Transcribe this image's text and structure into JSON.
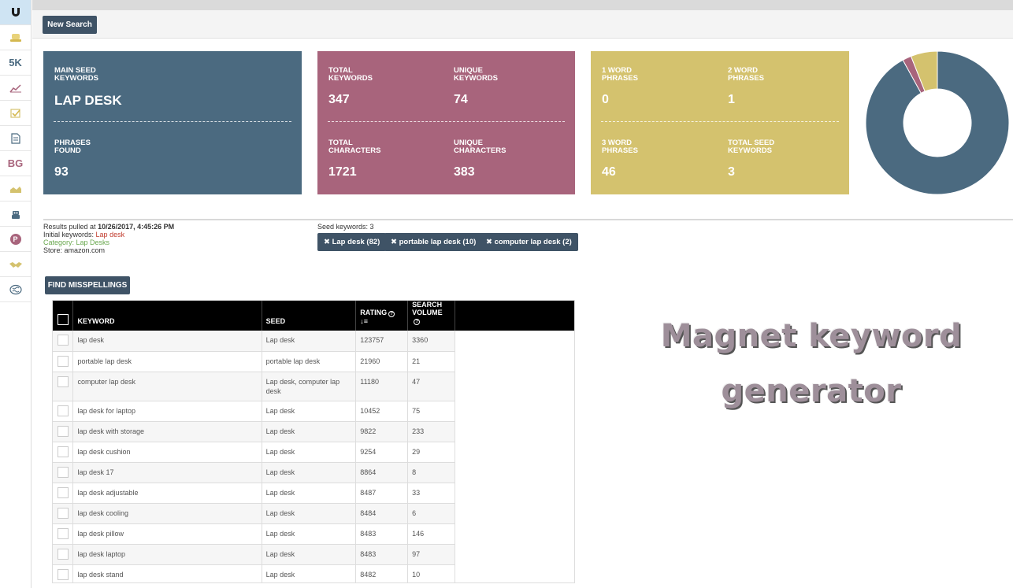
{
  "sidebar": {
    "items": [
      {
        "name": "magnet-icon",
        "text": ""
      },
      {
        "name": "hat-icon",
        "text": ""
      },
      {
        "name": "5k-icon",
        "text": "5K"
      },
      {
        "name": "chart-line-icon",
        "text": ""
      },
      {
        "name": "checklist-icon",
        "text": ""
      },
      {
        "name": "document-icon",
        "text": ""
      },
      {
        "name": "bg-icon",
        "text": "BG"
      },
      {
        "name": "area-chart-icon",
        "text": ""
      },
      {
        "name": "robot-icon",
        "text": ""
      },
      {
        "name": "p-circle-icon",
        "text": "P"
      },
      {
        "name": "handshake-icon",
        "text": ""
      },
      {
        "name": "brain-icon",
        "text": ""
      }
    ],
    "colors": {
      "active_bg": "#cfe4f3"
    }
  },
  "toolbar": {
    "new_search_label": "New Search"
  },
  "cards": {
    "seed": {
      "main_seed_label": "MAIN SEED KEYWORDS",
      "main_seed_value": "LAP DESK",
      "phrases_found_label": "PHRASES FOUND",
      "phrases_found_value": "93",
      "color": "#4b6a80"
    },
    "keywords": {
      "total_keywords_label": "TOTAL KEYWORDS",
      "total_keywords_value": "347",
      "unique_keywords_label": "UNIQUE KEYWORDS",
      "unique_keywords_value": "74",
      "total_characters_label": "TOTAL CHARACTERS",
      "total_characters_value": "1721",
      "unique_characters_label": "UNIQUE CHARACTERS",
      "unique_characters_value": "383",
      "color": "#a8647c"
    },
    "phrases": {
      "one_word_label": "1 WORD PHRASES",
      "one_word_value": "0",
      "two_word_label": "2 WORD PHRASES",
      "two_word_value": "1",
      "three_word_label": "3 WORD PHRASES",
      "three_word_value": "46",
      "total_seed_label": "TOTAL SEED KEYWORDS",
      "total_seed_value": "3",
      "color": "#d4c26e"
    }
  },
  "chart_data": {
    "type": "pie",
    "values": [
      46,
      1,
      3
    ],
    "colors": [
      "#4b6a80",
      "#a8647c",
      "#d4c26e"
    ],
    "hole": true
  },
  "info": {
    "results_pulled_prefix": "Results pulled at",
    "results_pulled_time": "10/26/2017, 4:45:26 PM",
    "initial_keywords_prefix": "Initial keywords:",
    "initial_keywords_value": "Lap desk",
    "category_text": "Category: Lap Desks",
    "store_text": "Store: amazon.com",
    "seed_keywords_text": "Seed keywords: 3"
  },
  "chips": [
    {
      "label": "✖ Lap desk (82)"
    },
    {
      "label": "✖ portable lap desk (10)"
    },
    {
      "label": "✖ computer lap desk (2)"
    }
  ],
  "find_misspellings_label": "FIND MISSPELLINGS",
  "table": {
    "headers": {
      "keyword": "KEYWORD",
      "seed": "SEED",
      "rating": "RATING",
      "search_volume": "SEARCH VOLUME"
    },
    "rows": [
      {
        "keyword": "lap desk",
        "seed": "Lap desk",
        "rating": "123757",
        "volume": "3360"
      },
      {
        "keyword": "portable lap desk",
        "seed": "portable lap desk",
        "rating": "21960",
        "volume": "21"
      },
      {
        "keyword": "computer lap desk",
        "seed": "Lap desk, computer lap desk",
        "rating": "11180",
        "volume": "47"
      },
      {
        "keyword": "lap desk for laptop",
        "seed": "Lap desk",
        "rating": "10452",
        "volume": "75"
      },
      {
        "keyword": "lap desk with storage",
        "seed": "Lap desk",
        "rating": "9822",
        "volume": "233"
      },
      {
        "keyword": "lap desk cushion",
        "seed": "Lap desk",
        "rating": "9254",
        "volume": "29"
      },
      {
        "keyword": "lap desk 17",
        "seed": "Lap desk",
        "rating": "8864",
        "volume": "8"
      },
      {
        "keyword": "lap desk adjustable",
        "seed": "Lap desk",
        "rating": "8487",
        "volume": "33"
      },
      {
        "keyword": "lap desk cooling",
        "seed": "Lap desk",
        "rating": "8484",
        "volume": "6"
      },
      {
        "keyword": "lap desk pillow",
        "seed": "Lap desk",
        "rating": "8483",
        "volume": "146"
      },
      {
        "keyword": "lap desk laptop",
        "seed": "Lap desk",
        "rating": "8483",
        "volume": "97"
      },
      {
        "keyword": "lap desk stand",
        "seed": "Lap desk",
        "rating": "8482",
        "volume": "10"
      }
    ]
  },
  "watermark": {
    "line1": "Magnet keyword",
    "line2": "generator"
  }
}
